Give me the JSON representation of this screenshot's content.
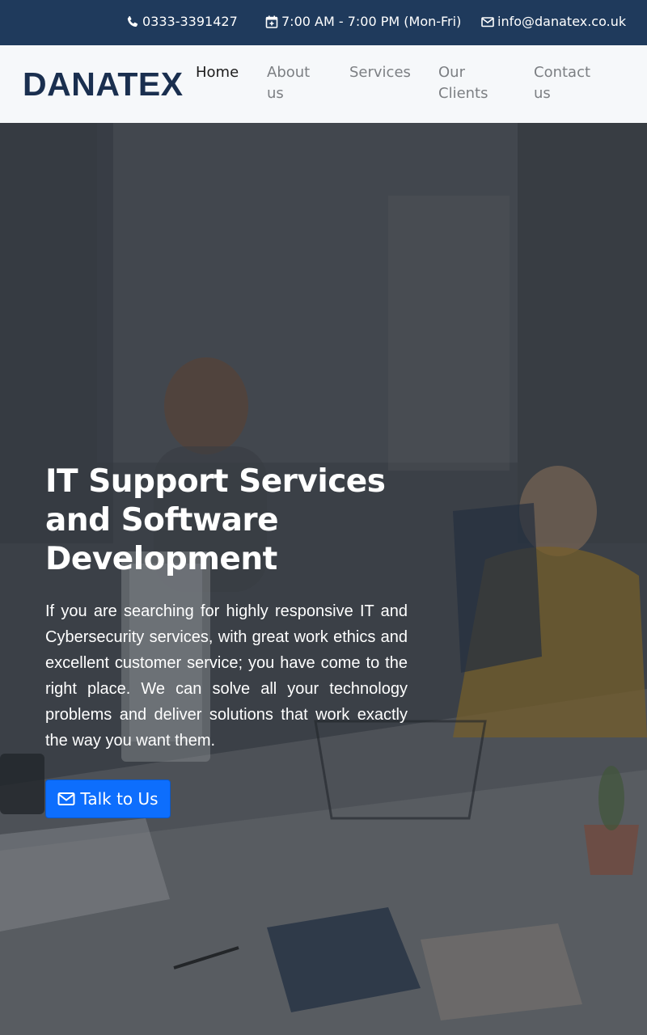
{
  "topbar": {
    "phone": "0333-3391427",
    "hours": "7:00 AM - 7:00 PM (Mon-Fri)",
    "email": "info@danatex.co.uk",
    "icons": [
      "phone-icon",
      "calendar-plus-icon",
      "envelope-icon"
    ]
  },
  "navbar": {
    "brand": "DANATEX",
    "links": [
      {
        "line1": "Home",
        "line2": ""
      },
      {
        "line1": "About",
        "line2": "us"
      },
      {
        "line1": "Services",
        "line2": ""
      },
      {
        "line1": "Our",
        "line2": "Clients"
      },
      {
        "line1": "Contact",
        "line2": "us"
      }
    ]
  },
  "hero": {
    "title": "IT Support Services and Software Development",
    "text": "If you are searching for highly responsive IT and Cybersecurity services, with great work ethics and excellent customer service; you have come to the right place. We can solve all your technology problems and deliver solutions that work exactly the way you want them.",
    "cta_label": "Talk to Us",
    "cta_icon": "envelope-icon"
  },
  "colors": {
    "topbar_bg": "#1f3a5c",
    "brand": "#1a2f4f",
    "cta_bg": "#0d6efd"
  }
}
